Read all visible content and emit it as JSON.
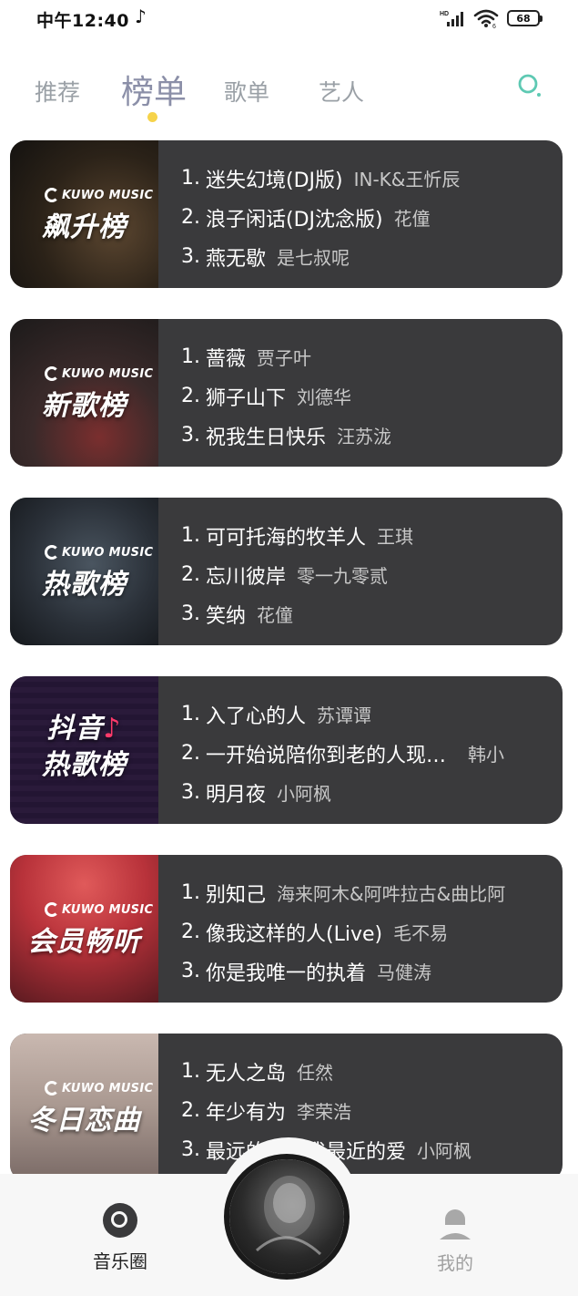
{
  "status_bar": {
    "time": "中午12:40",
    "notification_icon": "tiktok-icon",
    "network": "HD",
    "battery": "68"
  },
  "tabs": [
    {
      "label": "推荐",
      "active": false
    },
    {
      "label": "榜单",
      "active": true
    },
    {
      "label": "歌单",
      "active": false
    },
    {
      "label": "艺人",
      "active": false
    }
  ],
  "search_icon": "search-icon",
  "colors": {
    "card_bg": "#3a3a3c",
    "active_tab": "#8b8fa8",
    "inactive_tab": "#9aa0a6",
    "indicator": "#f6d34a",
    "search": "#5ec9b3"
  },
  "charts": [
    {
      "brand": "KUWO MUSIC",
      "title": "飙升榜",
      "tracks": [
        {
          "rank": "1.",
          "name": "迷失幻境(DJ版)",
          "artist": "IN-K&王忻辰"
        },
        {
          "rank": "2.",
          "name": "浪子闲话(DJ沈念版)",
          "artist": "花僮"
        },
        {
          "rank": "3.",
          "name": "燕无歇",
          "artist": "是七叔呢"
        }
      ]
    },
    {
      "brand": "KUWO MUSIC",
      "title": "新歌榜",
      "tracks": [
        {
          "rank": "1.",
          "name": "蔷薇",
          "artist": "贾子叶"
        },
        {
          "rank": "2.",
          "name": "狮子山下",
          "artist": "刘德华"
        },
        {
          "rank": "3.",
          "name": "祝我生日快乐",
          "artist": "汪苏泷"
        }
      ]
    },
    {
      "brand": "KUWO MUSIC",
      "title": "热歌榜",
      "tracks": [
        {
          "rank": "1.",
          "name": "可可托海的牧羊人",
          "artist": "王琪"
        },
        {
          "rank": "2.",
          "name": "忘川彼岸",
          "artist": "零一九零贰"
        },
        {
          "rank": "3.",
          "name": "笑纳",
          "artist": "花僮"
        }
      ]
    },
    {
      "brand": "",
      "title": "抖音热歌榜",
      "title_line1": "抖音",
      "title_line2": "热歌榜",
      "tracks": [
        {
          "rank": "1.",
          "name": "入了心的人",
          "artist": "苏谭谭"
        },
        {
          "rank": "2.",
          "name": "一开始说陪你到老的人现…",
          "artist": "韩小"
        },
        {
          "rank": "3.",
          "name": "明月夜",
          "artist": "小阿枫"
        }
      ]
    },
    {
      "brand": "KUWO MUSIC",
      "title": "会员畅听",
      "tracks": [
        {
          "rank": "1.",
          "name": "别知己",
          "artist": "海来阿木&阿吽拉古&曲比阿"
        },
        {
          "rank": "2.",
          "name": "像我这样的人(Live)",
          "artist": "毛不易"
        },
        {
          "rank": "3.",
          "name": "你是我唯一的执着",
          "artist": "马健涛"
        }
      ]
    },
    {
      "brand": "KUWO MUSIC",
      "title": "冬日恋曲",
      "tracks": [
        {
          "rank": "1.",
          "name": "无人之岛",
          "artist": "任然"
        },
        {
          "rank": "2.",
          "name": "年少有为",
          "artist": "李荣浩"
        },
        {
          "rank": "3.",
          "name": "最远的你是我最近的爱",
          "artist": "小阿枫"
        }
      ]
    }
  ],
  "bottom_nav": {
    "left": {
      "label": "音乐圈",
      "icon": "disc-icon",
      "active": true
    },
    "center": {
      "icon": "now-playing-disc"
    },
    "right": {
      "label": "我的",
      "icon": "person-icon",
      "active": false
    }
  }
}
